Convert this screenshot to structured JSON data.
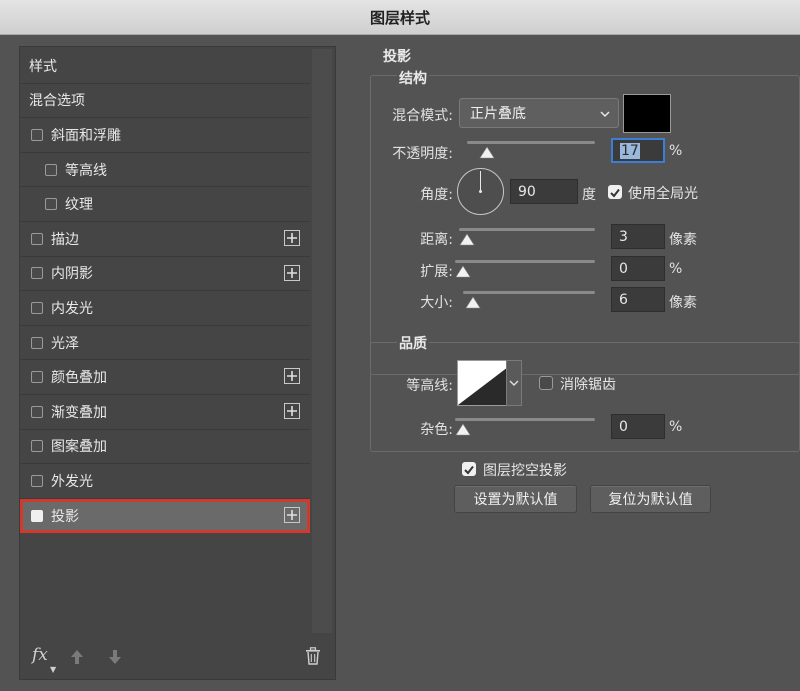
{
  "window": {
    "title": "图层样式"
  },
  "left_panel": {
    "items": [
      {
        "label": "样式",
        "type": "header"
      },
      {
        "label": "混合选项",
        "type": "header"
      },
      {
        "label": "斜面和浮雕",
        "checked": false,
        "indent": 1,
        "plus": false
      },
      {
        "label": "等高线",
        "checked": false,
        "indent": 2,
        "plus": false
      },
      {
        "label": "纹理",
        "checked": false,
        "indent": 2,
        "plus": false
      },
      {
        "label": "描边",
        "checked": false,
        "indent": 1,
        "plus": true
      },
      {
        "label": "内阴影",
        "checked": false,
        "indent": 1,
        "plus": true
      },
      {
        "label": "内发光",
        "checked": false,
        "indent": 1,
        "plus": false
      },
      {
        "label": "光泽",
        "checked": false,
        "indent": 1,
        "plus": false
      },
      {
        "label": "颜色叠加",
        "checked": false,
        "indent": 1,
        "plus": true
      },
      {
        "label": "渐变叠加",
        "checked": false,
        "indent": 1,
        "plus": true
      },
      {
        "label": "图案叠加",
        "checked": false,
        "indent": 1,
        "plus": false
      },
      {
        "label": "外发光",
        "checked": false,
        "indent": 1,
        "plus": false
      },
      {
        "label": "投影",
        "checked": true,
        "indent": 1,
        "plus": true,
        "selected": true
      }
    ],
    "footer": {
      "fx_label": "fx",
      "icons": [
        "arrow-up-icon",
        "arrow-down-icon",
        "trash-icon"
      ]
    }
  },
  "drop_shadow": {
    "section_title": "投影",
    "structure": {
      "title": "结构",
      "blend_mode_label": "混合模式:",
      "blend_mode_value": "正片叠底",
      "shadow_color": "#000000",
      "opacity_label": "不透明度:",
      "opacity_value": "17",
      "opacity_unit": "%",
      "angle_label": "角度:",
      "angle_value": "90",
      "angle_unit": "度",
      "global_light_label": "使用全局光",
      "global_light_checked": true,
      "distance_label": "距离:",
      "distance_value": "3",
      "distance_unit": "像素",
      "spread_label": "扩展:",
      "spread_value": "0",
      "spread_unit": "%",
      "size_label": "大小:",
      "size_value": "6",
      "size_unit": "像素"
    },
    "quality": {
      "title": "品质",
      "contour_label": "等高线:",
      "anti_aliased_label": "消除锯齿",
      "anti_aliased_checked": false,
      "noise_label": "杂色:",
      "noise_value": "0",
      "noise_unit": "%"
    },
    "knockout_label": "图层挖空投影",
    "knockout_checked": true,
    "make_default_label": "设置为默认值",
    "reset_default_label": "复位为默认值"
  },
  "colors": {
    "selection_outline": "#d03a2c",
    "focus_border": "#3d7dd6"
  }
}
